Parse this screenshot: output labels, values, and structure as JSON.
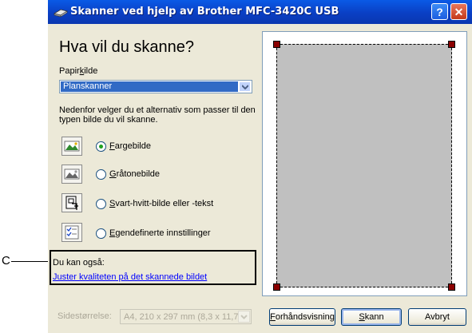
{
  "callout": {
    "letter": "C"
  },
  "window": {
    "title": "Skanner ved hjelp av Brother MFC-3420C USB",
    "help_button": "?",
    "close_button": "✕"
  },
  "heading": "Hva vil du skanne?",
  "paper_source": {
    "label_pre": "Papir",
    "label_key": "k",
    "label_post": "ilde",
    "selected": "Planskanner"
  },
  "description": "Nedenfor velger du et alternativ som passer til den typen bilde du vil skanne.",
  "options": [
    {
      "key": "F",
      "rest": "argebilde",
      "selected": true,
      "icon": "color-picture-icon"
    },
    {
      "key": "G",
      "rest": "råtonebilde",
      "selected": false,
      "icon": "grayscale-picture-icon"
    },
    {
      "key": "S",
      "rest": "vart-hvitt-bilde eller -tekst",
      "selected": false,
      "icon": "black-white-text-icon"
    },
    {
      "key": "E",
      "rest": "gendefinerte innstillinger",
      "selected": false,
      "icon": "custom-settings-icon"
    }
  ],
  "also": {
    "label": "Du kan også:",
    "link": "Juster kvaliteten på det skannede bildet"
  },
  "page_size": {
    "label": "Sidestørrelse:",
    "value": "A4, 210 x 297 mm (8,3 x 11,7"
  },
  "buttons": {
    "preview_key": "F",
    "preview_rest": "orhåndsvisning",
    "scan_key": "S",
    "scan_rest": "kann",
    "cancel": "Avbryt"
  }
}
